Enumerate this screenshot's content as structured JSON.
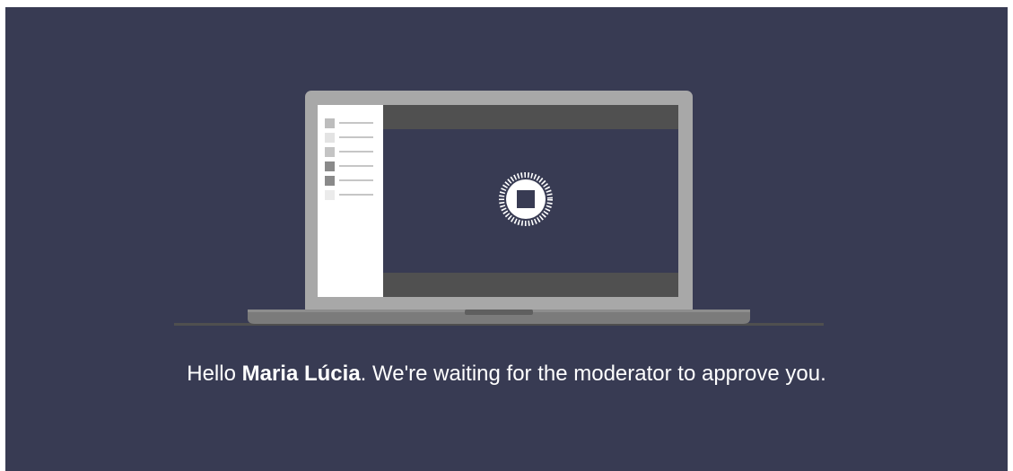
{
  "colors": {
    "background": "#383b53",
    "laptop_body": "#a8a8a8",
    "laptop_base": "#7b7b7b",
    "screen_bars": "#505050",
    "sidebar": "#ffffff",
    "video_area": "#383b53",
    "spinner": "#ffffff"
  },
  "illustration": {
    "name": "laptop-waiting-illustration",
    "sidebar_rows": 6
  },
  "message": {
    "greeting": "Hello",
    "user_name": "Maria Lúcia",
    "text": ". We're waiting for the moderator to approve you."
  }
}
